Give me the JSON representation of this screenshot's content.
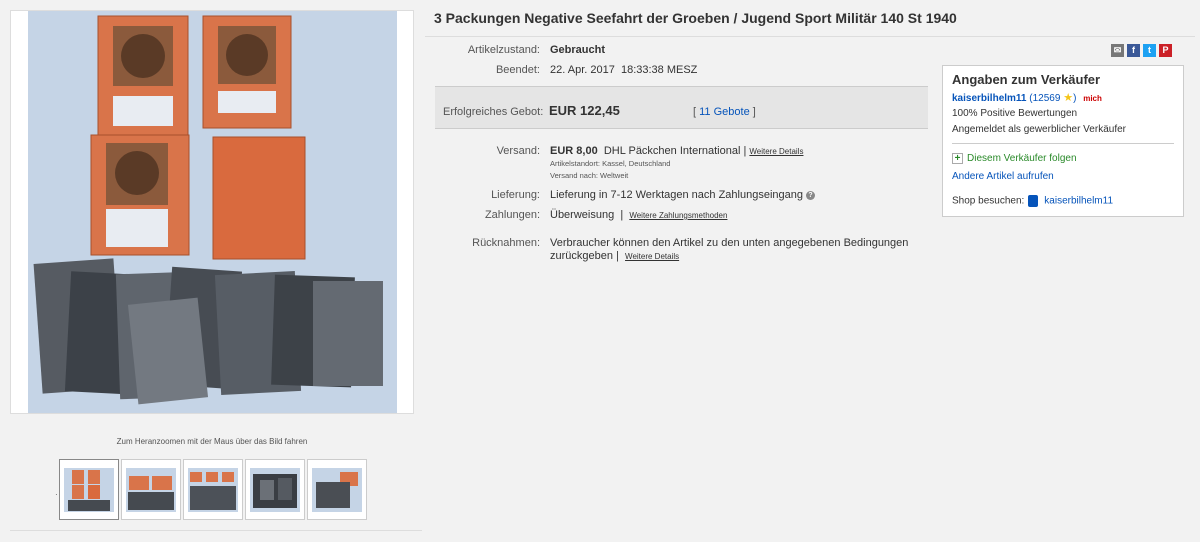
{
  "title": "3 Packungen Negative Seefahrt der Groeben / Jugend Sport Militär 140 St 1940",
  "gallery": {
    "zoom_hint": "Zum Heranzoomen mit der Maus über das Bild fahren",
    "thumb_count": 5,
    "active_thumb": 0
  },
  "details": {
    "condition_label": "Artikelzustand:",
    "condition_value": "Gebraucht",
    "ended_label": "Beendet:",
    "ended_date": "22. Apr. 2017",
    "ended_time": "18:33:38 MESZ"
  },
  "bid": {
    "label": "Erfolgreiches Gebot:",
    "price": "EUR 122,45",
    "bracket_open": "[",
    "count_link": "11 Gebote",
    "bracket_close": "]"
  },
  "shipping": {
    "label": "Versand:",
    "price": "EUR 8,00",
    "method": "DHL Päckchen International",
    "separator": "|",
    "details_link": "Weitere Details",
    "location": "Artikelstandort:  Kassel, Deutschland",
    "ships_to": "Versand nach:  Weltweit"
  },
  "delivery": {
    "label": "Lieferung:",
    "value": "Lieferung in 7-12 Werktagen nach Zahlungseingang",
    "help_icon": "question-circle-icon"
  },
  "payments": {
    "label": "Zahlungen:",
    "value": "Überweisung",
    "separator": "|",
    "more_link": "Weitere Zahlungsmethoden"
  },
  "returns": {
    "label": "Rücknahmen:",
    "line1": "Verbraucher können den Artikel zu den unten angegebenen Bedingungen",
    "line2": "zurückgeben |",
    "details_link": "Weitere Details"
  },
  "share": [
    {
      "icon": "email-icon",
      "color": "#777777",
      "glyph": "✉"
    },
    {
      "icon": "facebook-icon",
      "color": "#3b5998",
      "glyph": "f"
    },
    {
      "icon": "twitter-icon",
      "color": "#1da1f2",
      "glyph": "t"
    },
    {
      "icon": "pinterest-icon",
      "color": "#cb2027",
      "glyph": "P"
    }
  ],
  "seller": {
    "heading": "Angaben zum Verkäufer",
    "name": "kaiserbilhelm11",
    "score": "(12569",
    "score_close": ")",
    "me_badge": "mich",
    "positive": "100% Positive Bewertungen",
    "registered": "Angemeldet als gewerblicher Verkäufer",
    "follow": "Diesem Verkäufer folgen",
    "other_items": "Andere Artikel aufrufen",
    "shop_label": "Shop besuchen:",
    "shop_name": "kaiserbilhelm11"
  },
  "colors": {
    "link": "#0654ba",
    "follow": "#2a8a2a",
    "background": "#f2f2f2"
  }
}
